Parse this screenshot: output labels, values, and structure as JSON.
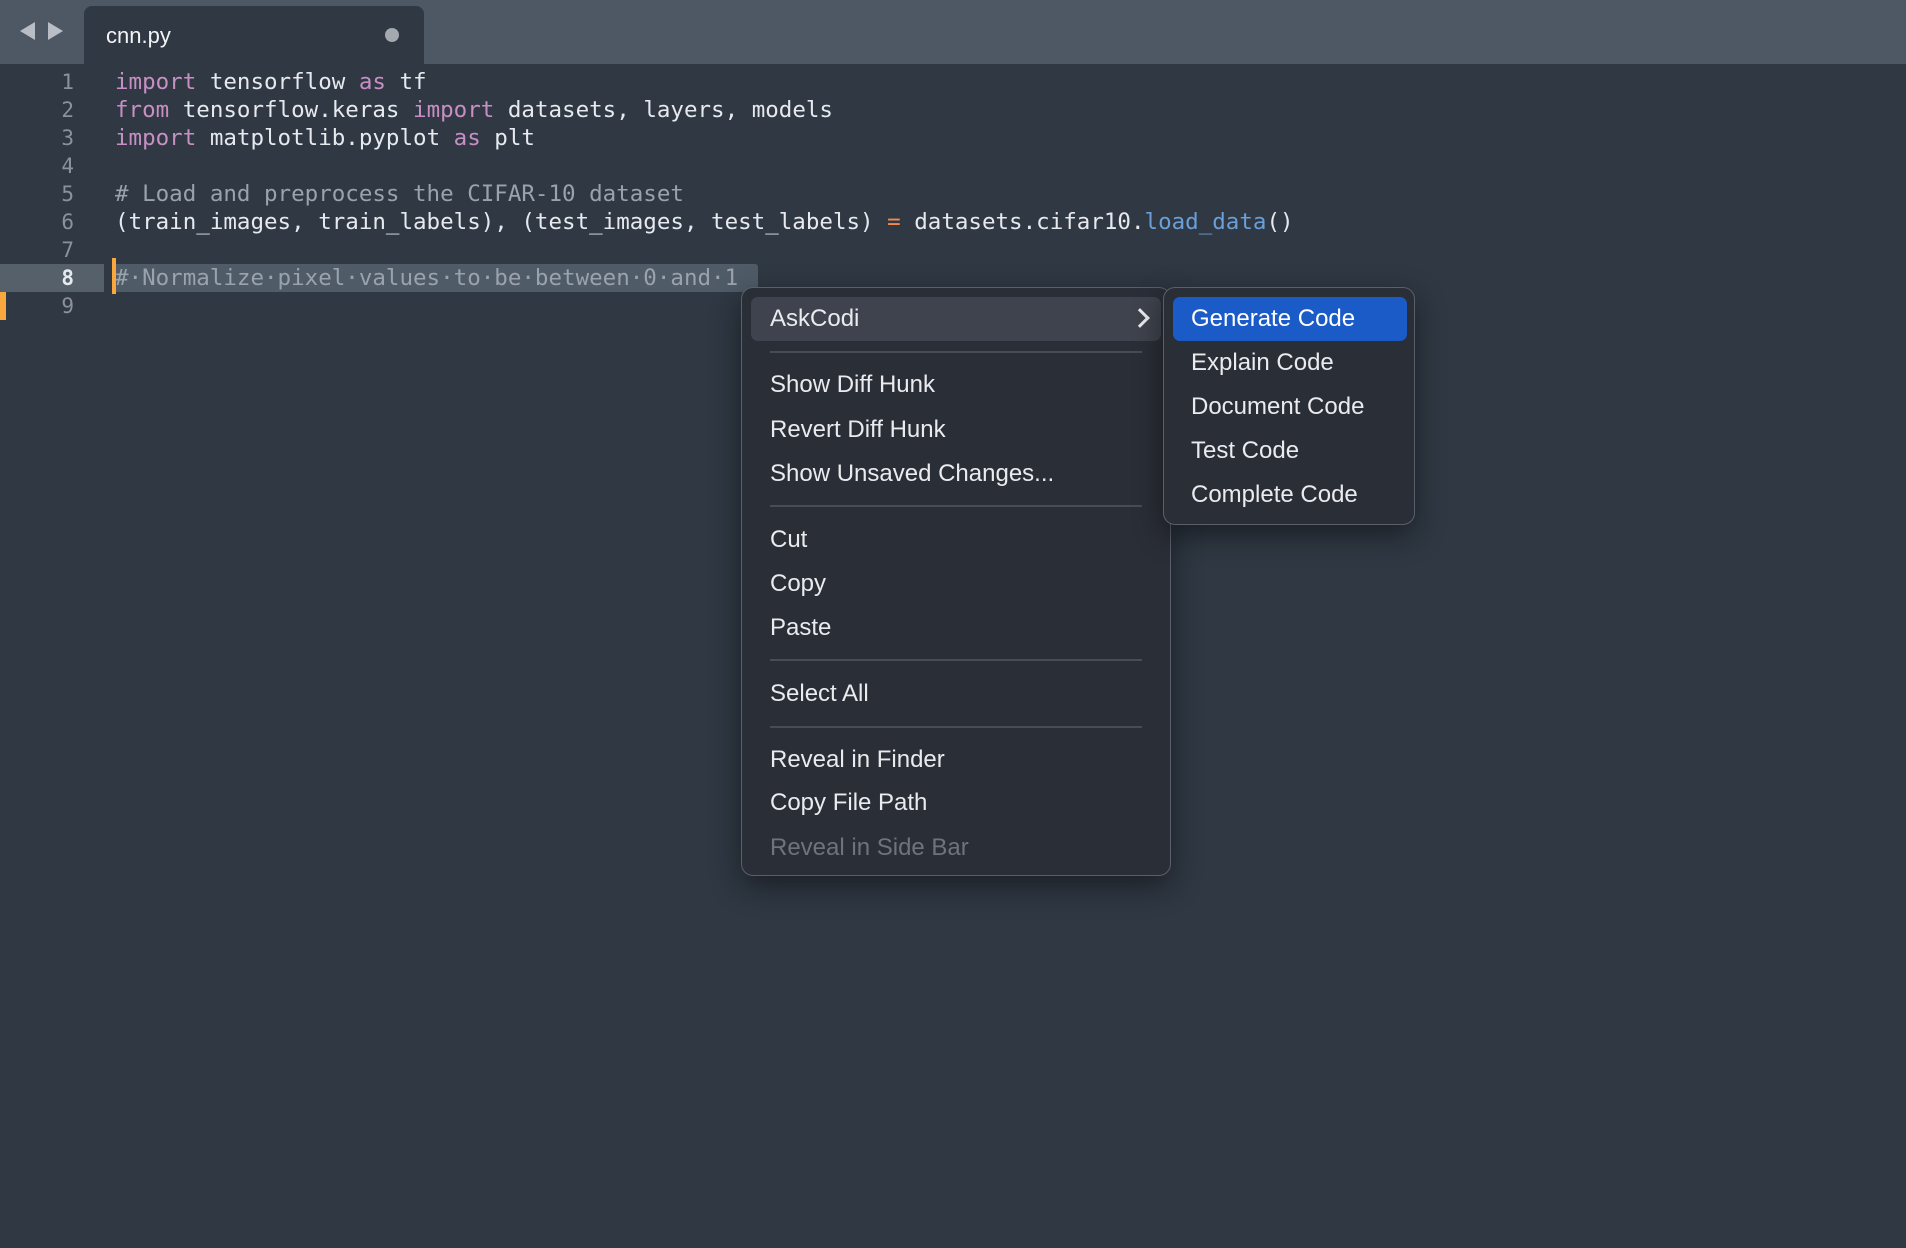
{
  "tabbar": {
    "back_icon": "triangle-left",
    "forward_icon": "triangle-right",
    "tabs": [
      {
        "label": "cnn.py",
        "dirty": true
      }
    ]
  },
  "editor": {
    "current_line": 8,
    "line_numbers": [
      "1",
      "2",
      "3",
      "4",
      "5",
      "6",
      "7",
      "8",
      "9"
    ],
    "lines": [
      [
        {
          "t": "kw",
          "v": "import"
        },
        {
          "t": "",
          "v": " tensorflow "
        },
        {
          "t": "kw",
          "v": "as"
        },
        {
          "t": "",
          "v": " tf"
        }
      ],
      [
        {
          "t": "kw",
          "v": "from"
        },
        {
          "t": "",
          "v": " tensorflow.keras "
        },
        {
          "t": "kw",
          "v": "import"
        },
        {
          "t": "",
          "v": " datasets, layers, models"
        }
      ],
      [
        {
          "t": "kw",
          "v": "import"
        },
        {
          "t": "",
          "v": " matplotlib.pyplot "
        },
        {
          "t": "kw",
          "v": "as"
        },
        {
          "t": "",
          "v": " plt"
        }
      ],
      [],
      [
        {
          "t": "cm",
          "v": "# Load and preprocess the CIFAR-10 dataset"
        }
      ],
      [
        {
          "t": "",
          "v": "(train_images, train_labels), (test_images, test_labels) "
        },
        {
          "t": "op",
          "v": "="
        },
        {
          "t": "",
          "v": " datasets.cifar10."
        },
        {
          "t": "fn",
          "v": "load_data"
        },
        {
          "t": "",
          "v": "()"
        }
      ],
      [],
      [
        {
          "t": "cm",
          "v": "#·Normalize·pixel·values·to·be·between·0·and·1"
        }
      ],
      []
    ]
  },
  "context_menu": {
    "items": [
      {
        "label": "AskCodi",
        "submenu": true,
        "highlighted": true
      },
      {
        "separator": true
      },
      {
        "label": "Show Diff Hunk"
      },
      {
        "label": "Revert Diff Hunk"
      },
      {
        "label": "Show Unsaved Changes..."
      },
      {
        "separator": true
      },
      {
        "label": "Cut"
      },
      {
        "label": "Copy"
      },
      {
        "label": "Paste"
      },
      {
        "separator": true
      },
      {
        "label": "Select All"
      },
      {
        "separator": true
      },
      {
        "label": "Reveal in Finder"
      },
      {
        "label": "Copy File Path"
      },
      {
        "label": "Reveal in Side Bar",
        "disabled": true
      }
    ]
  },
  "askcodi_submenu": {
    "items": [
      {
        "label": "Generate Code",
        "active": true
      },
      {
        "label": "Explain Code"
      },
      {
        "label": "Document Code"
      },
      {
        "label": "Test Code"
      },
      {
        "label": "Complete Code"
      }
    ]
  },
  "colors": {
    "background": "#2f3843",
    "tabbar": "#4d5864",
    "accent_selection": "#1a5bc7",
    "caret": "#f8a83c",
    "keyword": "#c78fc4",
    "function": "#6a9fd7",
    "operator": "#f58a4a",
    "comment": "#9aa2ac"
  }
}
